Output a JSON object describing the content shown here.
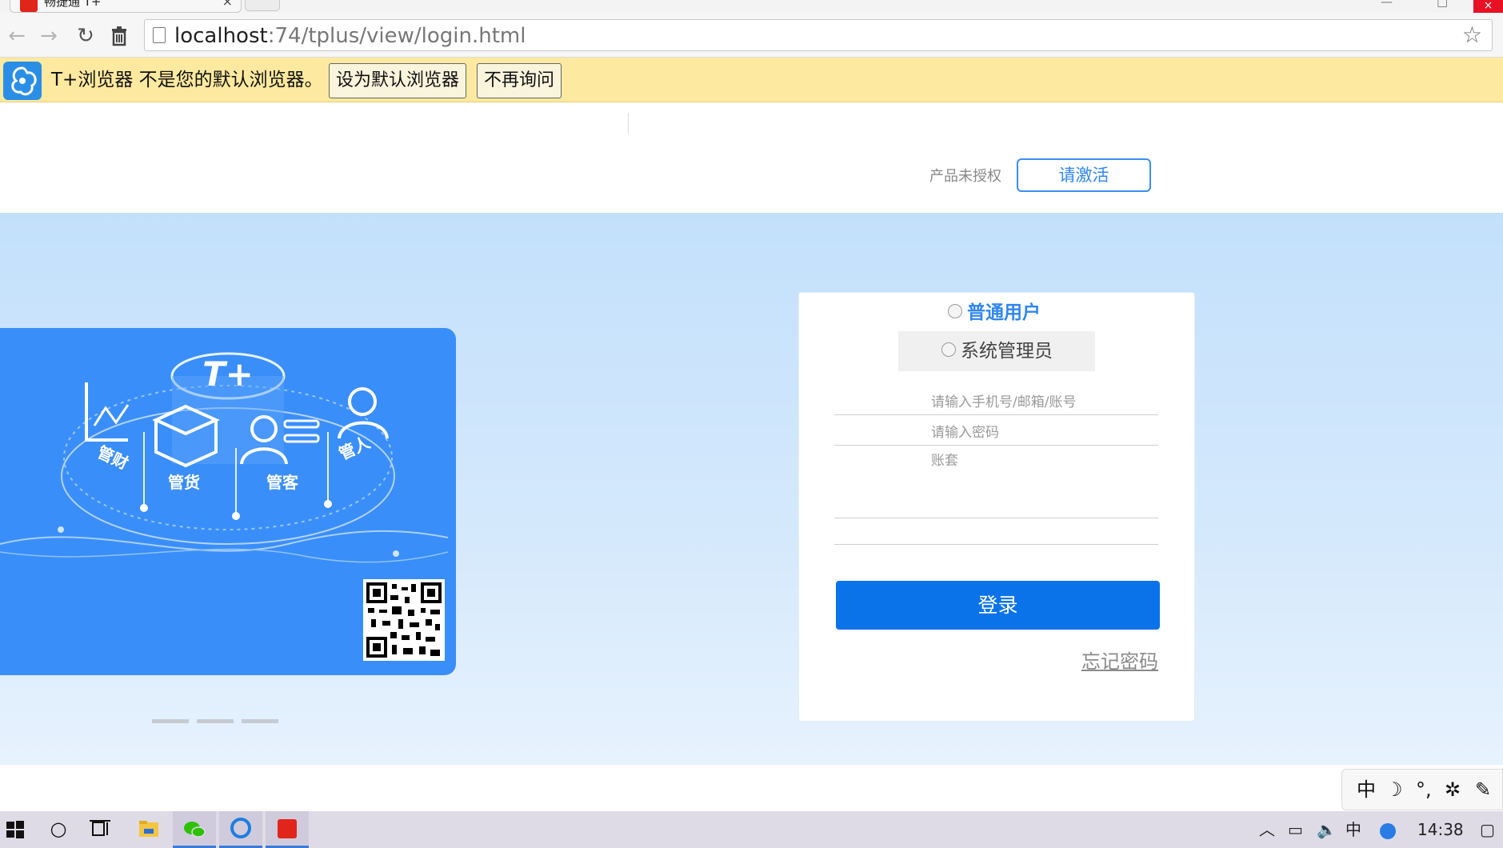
{
  "browser": {
    "tab_title": "畅捷通 T+",
    "tab_close": "×",
    "url_host": "localhost",
    "url_path": ":74/tplus/view/login.html",
    "win_min": "—",
    "win_max": "□",
    "win_close": "×"
  },
  "infobar": {
    "message": "T+浏览器 不是您的默认浏览器。",
    "set_default_label": "设为默认浏览器",
    "dont_ask_label": "不再询问"
  },
  "header": {
    "license_status": "产品未授权",
    "activate_label": "请激活"
  },
  "promo": {
    "logo_text": "T+",
    "labels": [
      "管财",
      "管货",
      "管客",
      "管人"
    ]
  },
  "login": {
    "role_user": "普通用户",
    "role_admin": "系统管理员",
    "account_placeholder": "请输入手机号/邮箱/账号",
    "password_placeholder": "请输入密码",
    "account_set_label": "账套",
    "login_label": "登录",
    "forgot_label": "忘记密码"
  },
  "ime": {
    "mode": "中",
    "moon": "☽",
    "punct": "°,",
    "gear": "✲"
  },
  "taskbar": {
    "search_glyph": "○",
    "tray_lang": "中",
    "clock": "14:38"
  },
  "colors": {
    "accent": "#0b73ea",
    "link_blue": "#2f86f0",
    "infobar_bg": "#fde99f",
    "hero_bg": "#c3e0fb",
    "promo_bg": "#3a8ef9"
  }
}
